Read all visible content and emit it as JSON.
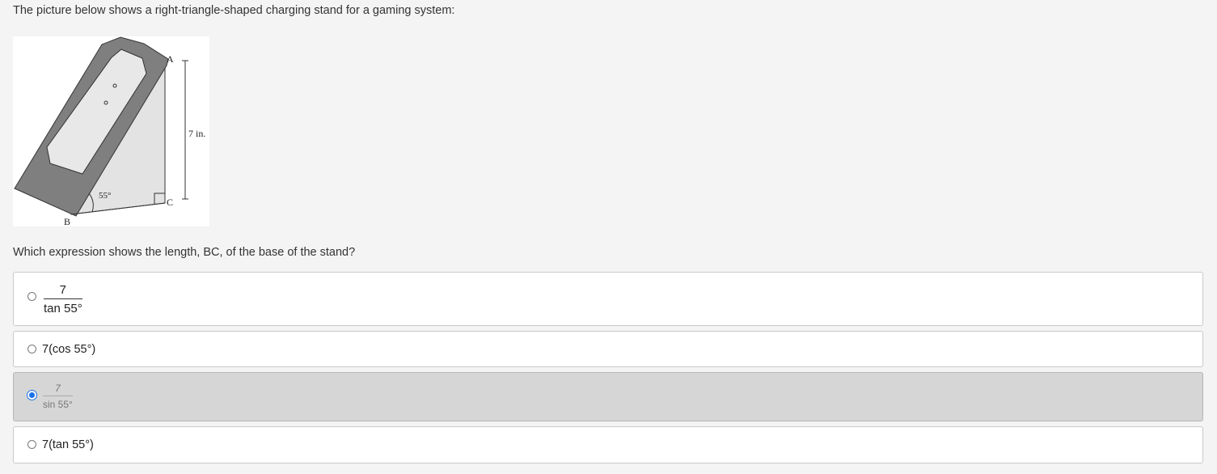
{
  "intro_text": "The picture below shows a right-triangle-shaped charging stand for a gaming system:",
  "figure": {
    "label_a": "A",
    "label_b": "B",
    "label_c": "C",
    "angle": "55°",
    "height": "7 in."
  },
  "question": "Which expression shows the length, BC, of the base of the stand?",
  "options": [
    {
      "numerator": "7",
      "denominator": "tan 55°",
      "selected": false
    },
    {
      "text": "7(cos 55°)",
      "selected": false
    },
    {
      "numerator": "7",
      "denominator": "sin 55°",
      "selected": true
    },
    {
      "text": "7(tan 55°)",
      "selected": false
    }
  ],
  "colors": {
    "selected_radio": "#1a73e8",
    "selected_background": "#d6d6d6"
  }
}
